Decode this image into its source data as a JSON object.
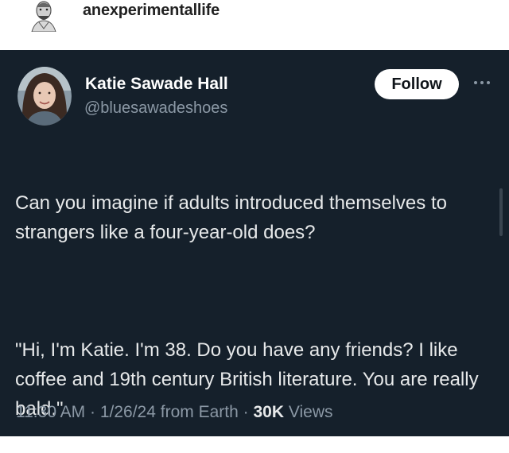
{
  "post": {
    "username": "anexperimentallife"
  },
  "tweet": {
    "display_name": "Katie Sawade Hall",
    "handle": "@bluesawadeshoes",
    "follow_label": "Follow",
    "paragraphs": [
      "Can you imagine if adults introduced themselves to strangers like a four-year-old does?",
      "\"Hi, I'm Katie. I'm 38. Do you have any friends? I like coffee and 19th century British literature. You are really bald.\""
    ],
    "meta": {
      "time": "11:30 AM",
      "date": "1/26/24",
      "source": "from Earth",
      "views_count": "30K",
      "views_label": "Views"
    }
  },
  "colors": {
    "tweet_background": "#15202b",
    "text_primary": "#e7e9ea",
    "text_secondary": "#8b98a5"
  },
  "icons": {
    "more": "more-horizontal-icon",
    "top_avatar": "user-avatar-illustration",
    "avatar": "user-avatar-photo"
  }
}
